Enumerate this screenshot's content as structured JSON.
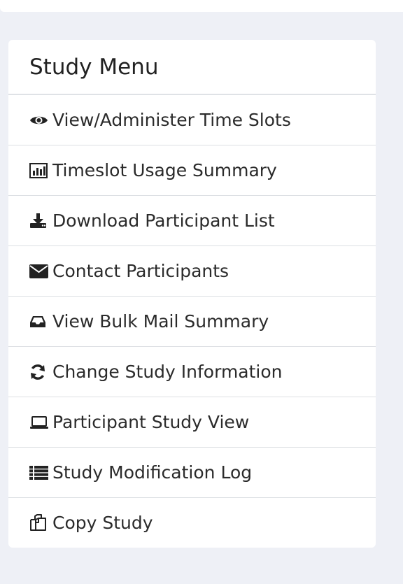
{
  "menu": {
    "title": "Study Menu",
    "items": [
      {
        "label": "View/Administer Time Slots",
        "icon": "eye-icon"
      },
      {
        "label": "Timeslot Usage Summary",
        "icon": "bar-chart-icon"
      },
      {
        "label": "Download Participant List",
        "icon": "download-icon"
      },
      {
        "label": "Contact Participants",
        "icon": "envelope-icon"
      },
      {
        "label": "View Bulk Mail Summary",
        "icon": "inbox-icon"
      },
      {
        "label": "Change Study Information",
        "icon": "refresh-icon"
      },
      {
        "label": "Participant Study View",
        "icon": "laptop-icon"
      },
      {
        "label": "Study Modification Log",
        "icon": "list-icon"
      },
      {
        "label": "Copy Study",
        "icon": "copy-icon"
      }
    ]
  }
}
